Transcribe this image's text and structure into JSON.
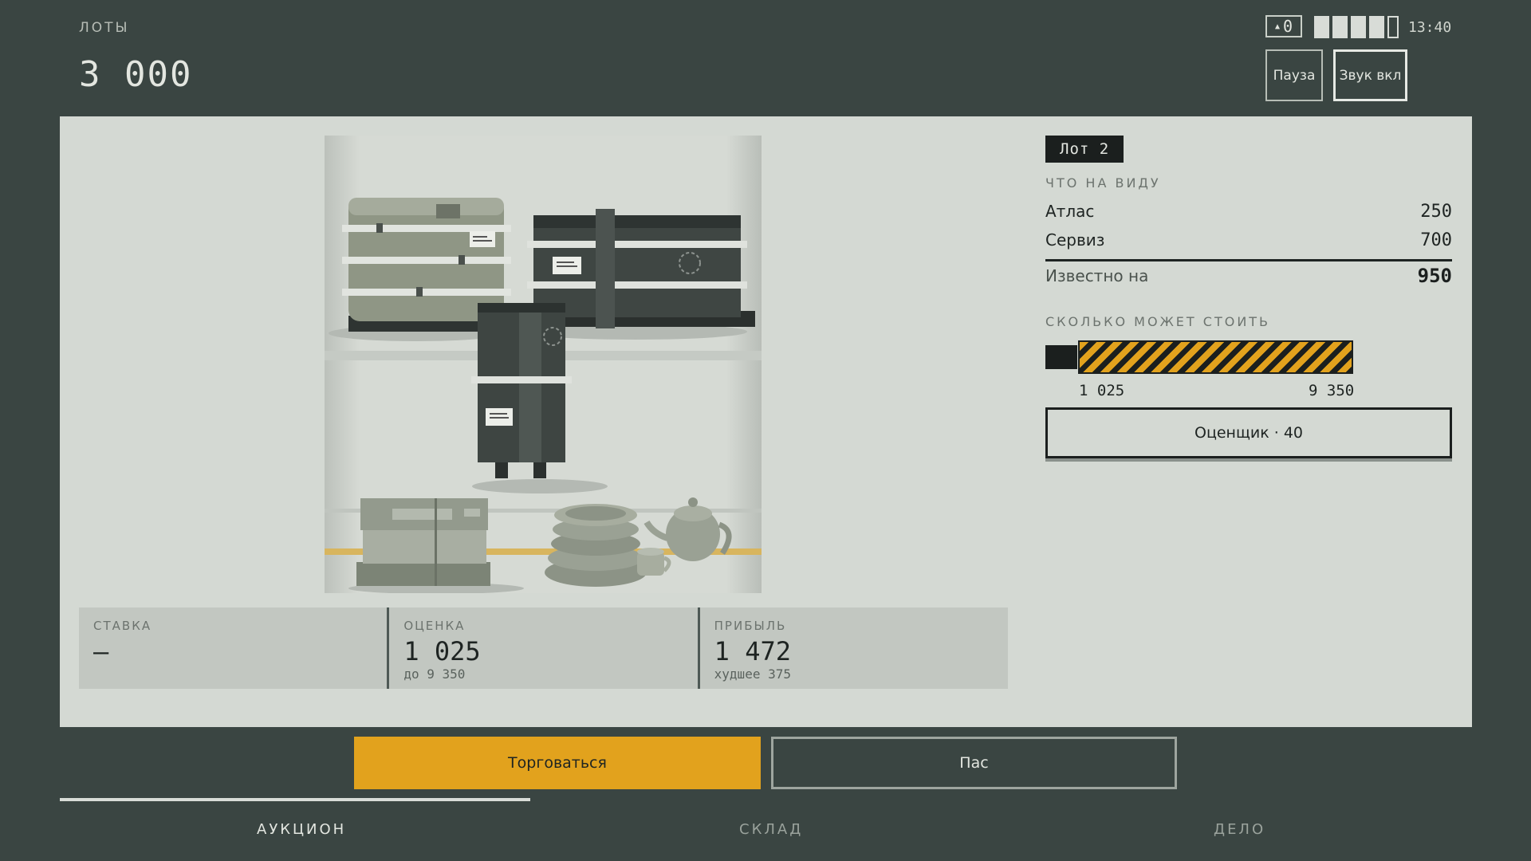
{
  "header": {
    "lots_label": "ЛОТЫ",
    "money": "3 000",
    "signal_value": "0",
    "battery_full_bars": 4,
    "battery_total_bars": 5,
    "clock": "13:40",
    "pause_label": "Пауза",
    "sound_label": "Звук вкл"
  },
  "stats": {
    "bid_label": "СТАВКА",
    "bid_value": "—",
    "estimate_label": "ОЦЕНКА",
    "estimate_value": "1 025",
    "estimate_sub": "до 9 350",
    "profit_label": "ПРИБЫЛЬ",
    "profit_value": "1 472",
    "profit_sub": "худшее 375"
  },
  "lot": {
    "badge": "Лот 2",
    "visible_title": "ЧТО НА ВИДУ",
    "items": [
      {
        "name": "Атлас",
        "value": "250"
      },
      {
        "name": "Сервиз",
        "value": "700"
      }
    ],
    "known_label": "Известно на",
    "known_value": "950",
    "worth_title": "СКОЛЬКО МОЖЕТ СТОИТЬ",
    "range_low": "1 025",
    "range_high": "9 350",
    "appraiser_label": "Оценщик · 40"
  },
  "actions": {
    "trade_label": "Торговаться",
    "pass_label": "Пас"
  },
  "tabs": [
    {
      "label": "АУКЦИОН",
      "active": true
    },
    {
      "label": "СКЛАД",
      "active": false
    },
    {
      "label": "ДЕЛО",
      "active": false
    }
  ],
  "colors": {
    "background": "#3a4542",
    "panel": "#d4d9d3",
    "accent": "#e2a21d",
    "dark": "#1b1f1e"
  }
}
